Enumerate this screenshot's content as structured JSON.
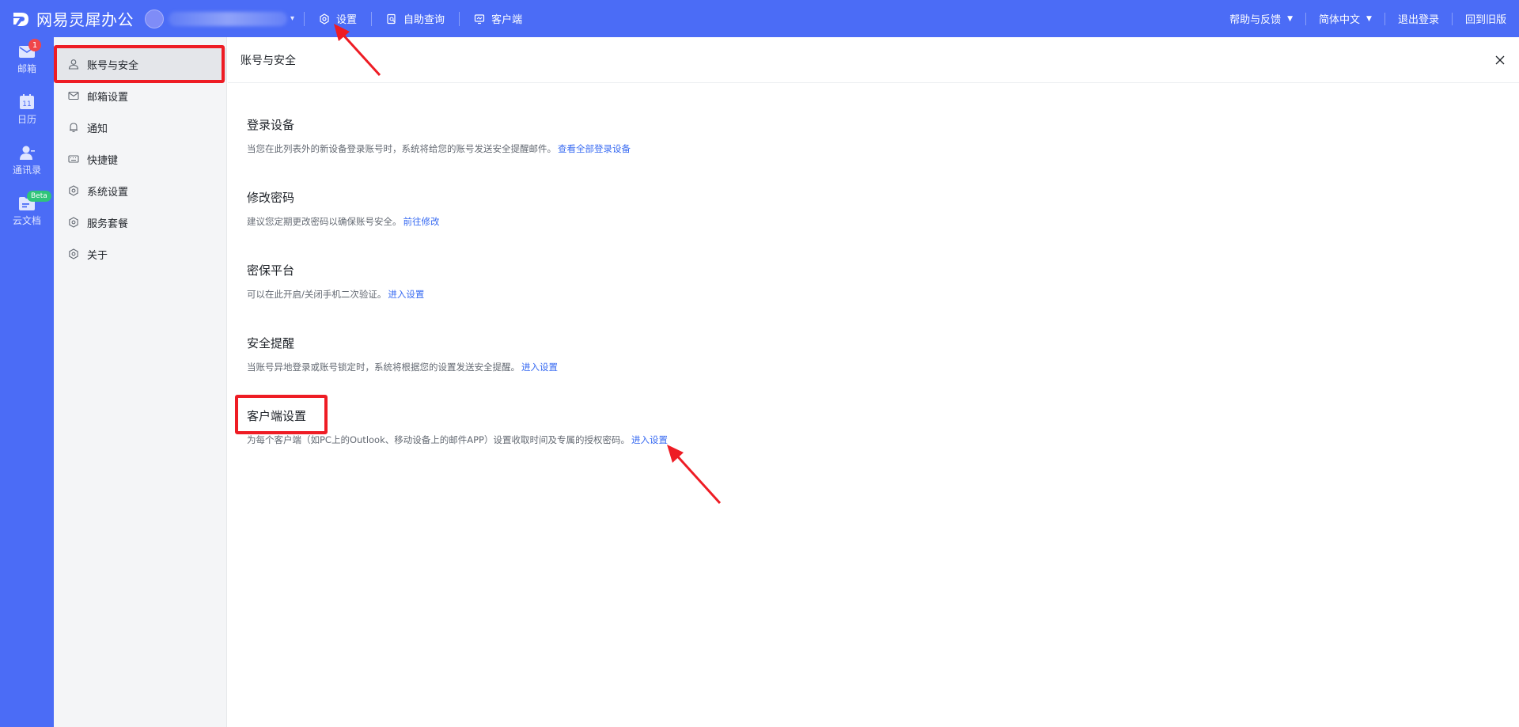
{
  "brand": {
    "name": "网易灵犀办公",
    "color": "#4b6cf6"
  },
  "topnav": {
    "items": [
      {
        "icon": "gear-icon",
        "label": "设置"
      },
      {
        "icon": "search-doc-icon",
        "label": "自助查询"
      },
      {
        "icon": "monitor-icon",
        "label": "客户端"
      }
    ],
    "right": {
      "help_label": "帮助与反馈",
      "lang_label": "简体中文",
      "logout_label": "退出登录",
      "old_version_label": "回到旧版"
    }
  },
  "rail": {
    "items": [
      {
        "icon": "mail-icon",
        "label": "邮箱",
        "badge": "1"
      },
      {
        "icon": "calendar-icon",
        "label": "日历",
        "day": "11"
      },
      {
        "icon": "contacts-icon",
        "label": "通讯录"
      },
      {
        "icon": "cloud-doc-icon",
        "label": "云文档",
        "tag": "Beta"
      }
    ]
  },
  "sidebar": {
    "items": [
      {
        "icon": "user-icon",
        "label": "账号与安全",
        "active": true
      },
      {
        "icon": "mail-outline-icon",
        "label": "邮箱设置"
      },
      {
        "icon": "bell-icon",
        "label": "通知"
      },
      {
        "icon": "keyboard-icon",
        "label": "快捷键"
      },
      {
        "icon": "hex-gear-icon",
        "label": "系统设置"
      },
      {
        "icon": "hex-gear-icon",
        "label": "服务套餐"
      },
      {
        "icon": "hex-gear-icon",
        "label": "关于"
      }
    ]
  },
  "main": {
    "title": "账号与安全",
    "sections": [
      {
        "title": "登录设备",
        "desc": "当您在此列表外的新设备登录账号时，系统将给您的账号发送安全提醒邮件。",
        "link": "查看全部登录设备"
      },
      {
        "title": "修改密码",
        "desc": "建议您定期更改密码以确保账号安全。",
        "link": "前往修改"
      },
      {
        "title": "密保平台",
        "desc": "可以在此开启/关闭手机二次验证。",
        "link": "进入设置"
      },
      {
        "title": "安全提醒",
        "desc": "当账号异地登录或账号锁定时，系统将根据您的设置发送安全提醒。",
        "link": "进入设置"
      },
      {
        "title": "客户端设置",
        "desc": "为每个客户端（如PC上的Outlook、移动设备上的邮件APP）设置收取时间及专属的授权密码。",
        "link": "进入设置"
      }
    ]
  },
  "colors": {
    "link": "#3a6cf2",
    "annotation": "#ee1c24",
    "badge": "#f0464a",
    "beta": "#2fc47a"
  }
}
